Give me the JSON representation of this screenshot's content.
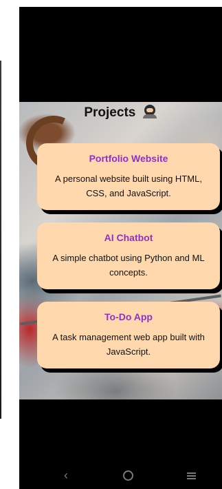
{
  "page": {
    "title": "Projects"
  },
  "projects": [
    {
      "title": "Portfolio Website",
      "description": "A personal website built using HTML, CSS, and JavaScript."
    },
    {
      "title": "AI Chatbot",
      "description": "A simple chatbot using Python and ML concepts."
    },
    {
      "title": "To-Do App",
      "description": "A task management web app built with JavaScript."
    }
  ],
  "icons": {
    "title_emoji": "ninja-icon",
    "nav_back": "back-chevron-icon",
    "nav_home": "home-circle-icon",
    "nav_recents": "recents-lines-icon"
  },
  "colors": {
    "card_background": "#ffd8ad",
    "card_title": "#8e31c4",
    "card_shadow": "#000000",
    "nav_icon": "#7a7a7a"
  }
}
